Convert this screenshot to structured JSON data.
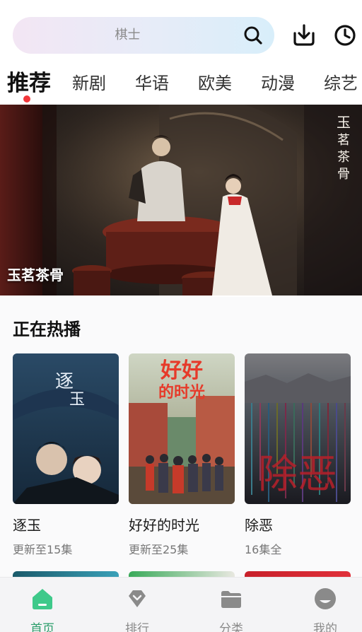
{
  "search": {
    "placeholder_text": "棋士"
  },
  "tabs": [
    {
      "label": "推荐",
      "active": true
    },
    {
      "label": "新剧"
    },
    {
      "label": "华语"
    },
    {
      "label": "欧美"
    },
    {
      "label": "动漫"
    },
    {
      "label": "综艺"
    }
  ],
  "banner": {
    "title": "玉茗茶骨",
    "logo_text": "玉茗茶骨"
  },
  "section": {
    "title": "正在热播"
  },
  "cards": [
    {
      "title": "逐玉",
      "status": "更新至15集",
      "poster_text": "逐玉"
    },
    {
      "title": "好好的时光",
      "status": "更新至25集",
      "poster_text": "好好的时光"
    },
    {
      "title": "除恶",
      "status": "16集全",
      "poster_text": "除恶"
    }
  ],
  "nav": [
    {
      "label": "首页",
      "icon": "home-icon",
      "active": true
    },
    {
      "label": "排行",
      "icon": "ranking-icon"
    },
    {
      "label": "分类",
      "icon": "category-icon"
    },
    {
      "label": "我的",
      "icon": "profile-icon"
    }
  ],
  "colors": {
    "accent": "#2a9d6a",
    "tab_dot": "#f2363a"
  }
}
